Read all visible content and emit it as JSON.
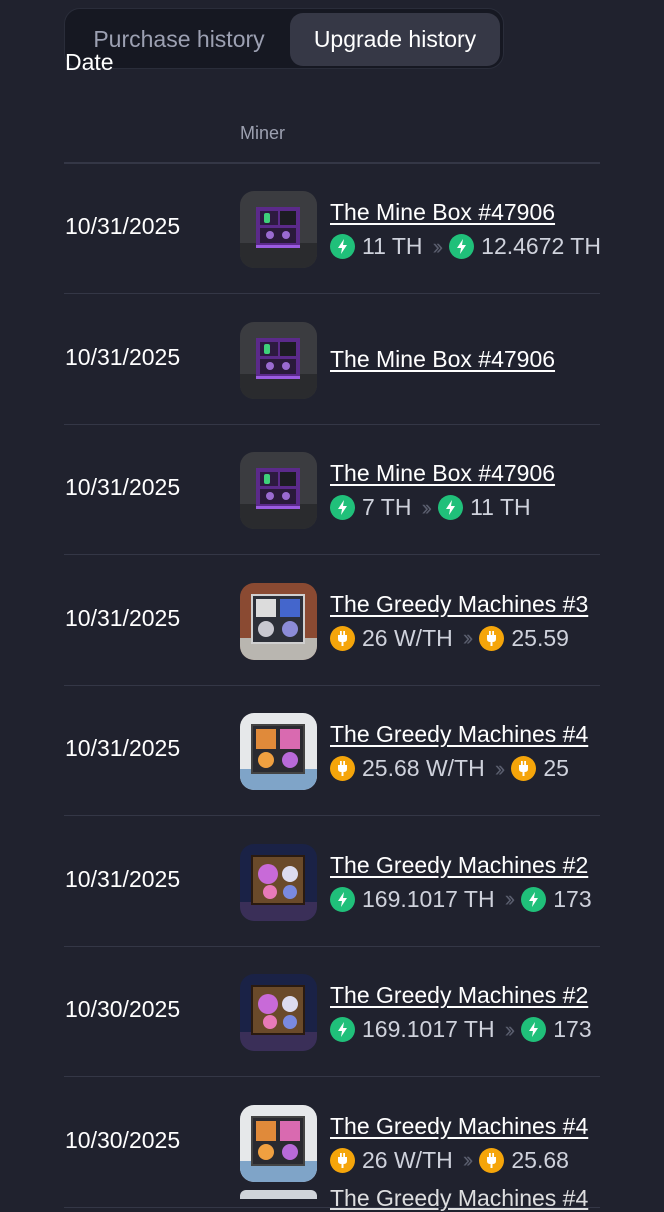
{
  "tabs": [
    {
      "label": "Purchase history",
      "active": false
    },
    {
      "label": "Upgrade history",
      "active": true
    }
  ],
  "table": {
    "columns": [
      "Date",
      "Miner"
    ],
    "rows": [
      {
        "date": "10/31/2025",
        "name": "The Mine Box #47906",
        "thumb": "mine-box",
        "stat": {
          "icon": "bolt-icon",
          "color": "#20c07a",
          "from": "11 TH",
          "to": "12.4672 TH"
        }
      },
      {
        "date": "10/31/2025",
        "name": "The Mine Box #47906",
        "thumb": "mine-box",
        "stat": null
      },
      {
        "date": "10/31/2025",
        "name": "The Mine Box #47906",
        "thumb": "mine-box",
        "stat": {
          "icon": "bolt-icon",
          "color": "#20c07a",
          "from": "7 TH",
          "to": "11 TH"
        }
      },
      {
        "date": "10/31/2025",
        "name": "The Greedy Machines #3",
        "thumb": "greedy-3",
        "stat": {
          "icon": "plug-icon",
          "color": "#f5a50a",
          "from": "26 W/TH",
          "to": "25.59"
        }
      },
      {
        "date": "10/31/2025",
        "name": "The Greedy Machines #4",
        "thumb": "greedy-4",
        "stat": {
          "icon": "plug-icon",
          "color": "#f5a50a",
          "from": "25.68 W/TH",
          "to": "25"
        }
      },
      {
        "date": "10/31/2025",
        "name": "The Greedy Machines #2",
        "thumb": "greedy-2",
        "stat": {
          "icon": "bolt-icon",
          "color": "#20c07a",
          "from": "169.1017 TH",
          "to": "173"
        }
      },
      {
        "date": "10/30/2025",
        "name": "The Greedy Machines #2",
        "thumb": "greedy-2",
        "stat": {
          "icon": "bolt-icon",
          "color": "#20c07a",
          "from": "169.1017 TH",
          "to": "173"
        }
      },
      {
        "date": "10/30/2025",
        "name": "The Greedy Machines #4",
        "thumb": "greedy-4",
        "stat": {
          "icon": "plug-icon",
          "color": "#f5a50a",
          "from": "26 W/TH",
          "to": "25.68"
        }
      }
    ],
    "partial_row_name": "The Greedy Machines #4"
  },
  "colors": {
    "background": "#20222e",
    "green_accent": "#20c07a",
    "orange_accent": "#f5a50a",
    "divider": "#343746"
  }
}
